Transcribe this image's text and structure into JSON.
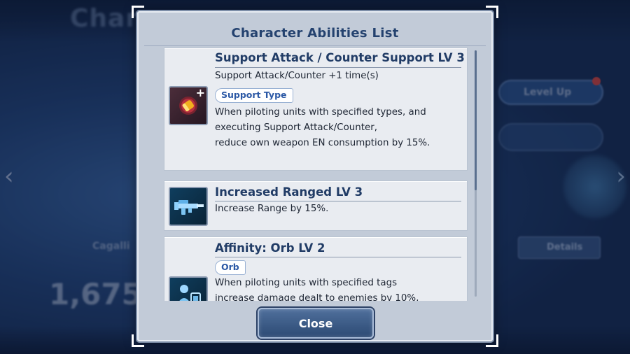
{
  "dialog": {
    "title": "Character Abilities List",
    "close_label": "Close"
  },
  "abilities": [
    {
      "title": "Support Attack / Counter Support LV 3",
      "subtitle": "Support Attack/Counter +1 time(s)",
      "tag": "Support Type",
      "description_lines": [
        "When piloting units with specified types, and",
        "executing Support Attack/Counter,",
        "reduce own weapon EN consumption by 15%."
      ],
      "icon": "support-attack-icon"
    },
    {
      "title": "Increased Ranged LV 3",
      "description_lines": [
        "Increase Range by 15%."
      ],
      "icon": "ranged-weapon-icon"
    },
    {
      "title": "Affinity: Orb LV 2",
      "tag": "Orb",
      "description_lines": [
        "When piloting units with specified tags",
        "increase damage dealt to enemies by 10%,"
      ],
      "icon": "orb-affinity-icon"
    }
  ],
  "background": {
    "title": "Charac",
    "level_up_label": "Level Up",
    "details_label": "Details",
    "power_value": "1,675",
    "pilot_name": "Cagalli"
  },
  "colors": {
    "title_blue": "#24426f",
    "tag_blue": "#2b58a5",
    "panel_bg": "#c2cbd8",
    "card_bg": "#e9ecf1"
  }
}
